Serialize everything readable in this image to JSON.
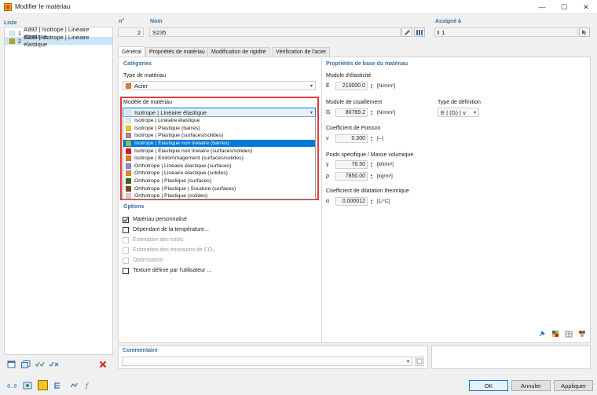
{
  "window": {
    "title": "Modifier le matériau",
    "minimize": "—",
    "maximize": "☐",
    "close": "✕"
  },
  "list": {
    "header": "Liste",
    "items": [
      {
        "num": "1",
        "label": "A992 | Isotrope | Linéaire élastique",
        "color": "#d8ecf6"
      },
      {
        "num": "2",
        "label": "S235 | Isotrope | Linéaire élastique",
        "color": "#b8a32a"
      }
    ]
  },
  "header": {
    "num_label": "n°",
    "num_value": "2",
    "name_label": "Nom",
    "name_value": "S235",
    "assigned_label": "Assigné à",
    "assigned_value": "1"
  },
  "tabs": [
    "Général",
    "Propriétés de matériau",
    "Modification de rigidité",
    "Vérification de l'acier"
  ],
  "categories": {
    "header": "Catégories",
    "type_label": "Type de matériau",
    "type_value": "Acier",
    "type_color": "#e07a3a",
    "model_label": "Modèle de matériau",
    "model_value": "Isotrope | Linéaire élastique",
    "model_color": "#d8ecf6",
    "options": [
      {
        "label": "Isotrope | Linéaire élastique",
        "color": "#d8ecf6"
      },
      {
        "label": "Isotrope | Plastique (barres)",
        "color": "#f2c219"
      },
      {
        "label": "Isotrope | Plastique (surfaces/solides)",
        "color": "#b07f96"
      },
      {
        "label": "Isotrope | Élastique non linéaire (barres)",
        "color": "#8bc34a",
        "selected": true
      },
      {
        "label": "Isotrope | Élastique non linéaire (surfaces/solides)",
        "color": "#d81a1a"
      },
      {
        "label": "Isotrope | Endommagement (surfaces/solides)",
        "color": "#e8741f"
      },
      {
        "label": "Orthotrope | Linéaire élastique (surfaces)",
        "color": "#8a8ad8"
      },
      {
        "label": "Orthotrope | Linéaire élastique (solides)",
        "color": "#d98a3a"
      },
      {
        "label": "Orthotrope | Plastique (surfaces)",
        "color": "#2f6b1f"
      },
      {
        "label": "Orthotrope | Plastique | Soudure (surfaces)",
        "color": "#7a4a1f"
      },
      {
        "label": "Orthotrope | Plastique (solides)",
        "color": "#f2c9b8"
      }
    ]
  },
  "options": {
    "header": "Options",
    "items": [
      {
        "label": "Matériau personnalisé",
        "checked": true,
        "enabled": true
      },
      {
        "label": "Dépendant de la température...",
        "checked": false,
        "enabled": true
      },
      {
        "label": "Estimation des coûts",
        "checked": false,
        "enabled": false
      },
      {
        "label": "Estimation des émissions de CO₂",
        "checked": false,
        "enabled": false
      },
      {
        "label": "Optimisation",
        "checked": false,
        "enabled": false
      },
      {
        "label": "Texture définie par l'utilisateur ...",
        "checked": false,
        "enabled": true
      }
    ]
  },
  "props": {
    "header": "Propriétés de base du matériau",
    "e_label": "Module d'élasticité",
    "e_sym": "E",
    "e_value": "210000.0",
    "e_unit": "[N/mm²]",
    "g_label": "Module de cisaillement",
    "g_sym": "G",
    "g_value": "80769.2",
    "g_unit": "[N/mm²]",
    "def_label": "Type de définition",
    "def_value": "E | (G) | ν",
    "nu_label": "Coefficient de Poisson",
    "nu_sym": "ν",
    "nu_value": "0.300",
    "nu_unit": "[--]",
    "w_label": "Poids spécifique / Masse volumique",
    "gamma_sym": "γ",
    "gamma_value": "78.50",
    "gamma_unit": "[kN/m³]",
    "rho_sym": "ρ",
    "rho_value": "7850.00",
    "rho_unit": "[kg/m³]",
    "a_label": "Coefficient de dilatation thermique",
    "a_sym": "α",
    "a_value": "0.000012",
    "a_unit": "[1/°C]"
  },
  "comment": {
    "label": "Commentaire"
  },
  "buttons": {
    "ok": "OK",
    "cancel": "Annuler",
    "apply": "Appliquer"
  }
}
